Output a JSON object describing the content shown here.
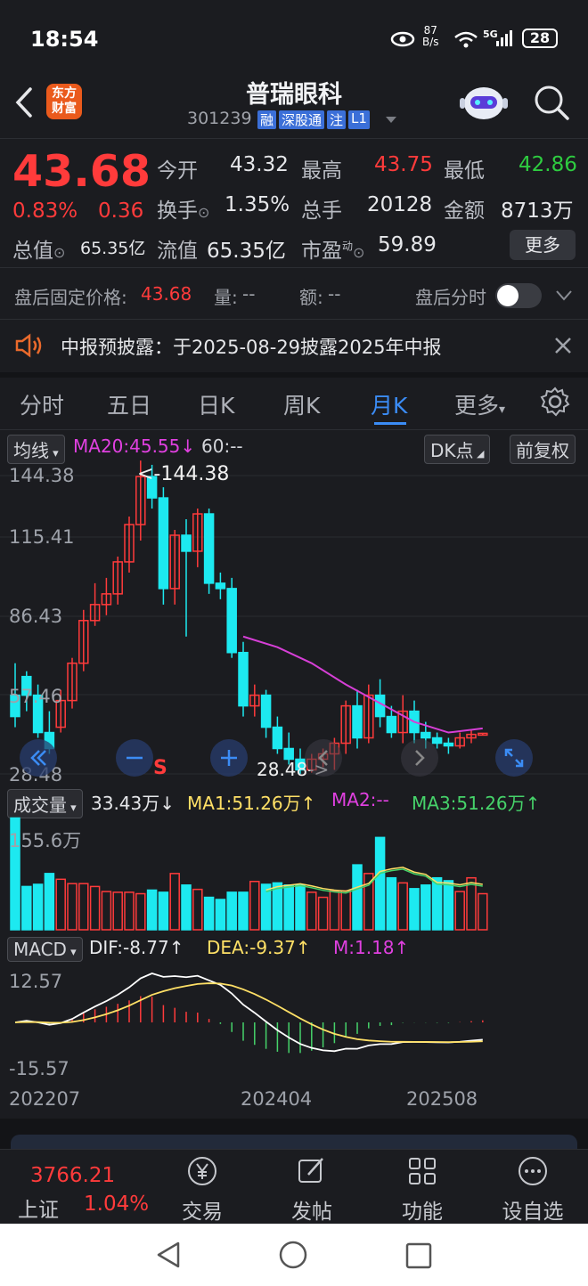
{
  "status": {
    "time": "18:54",
    "net_speed_value": "87",
    "net_speed_unit": "B/s",
    "signal": "5G",
    "battery": "28"
  },
  "header": {
    "app_logo_line1": "东方",
    "app_logo_line2": "财富",
    "stock_name": "普瑞眼科",
    "stock_code": "301239",
    "tags": [
      "融",
      "深股通",
      "注",
      "L1"
    ]
  },
  "quote": {
    "price": "43.68",
    "change_pct": "0.83%",
    "change": "0.36",
    "open_label": "今开",
    "open": "43.32",
    "high_label": "最高",
    "high": "43.75",
    "low_label": "最低",
    "low": "42.86",
    "turnover_label": "换手",
    "turnover": "1.35%",
    "volume_label": "总手",
    "volume": "20128",
    "amount_label": "金额",
    "amount": "8713万",
    "mktcap_label": "总值",
    "mktcap": "65.35亿",
    "float_label": "流值",
    "float_cap": "65.35亿",
    "pe_label": "市盈",
    "pe_sup": "动",
    "pe": "59.89",
    "more_label": "更多"
  },
  "afterhours": {
    "price_label": "盘后固定价格:",
    "price": "43.68",
    "vol_label": "量:",
    "vol": "--",
    "amt_label": "额:",
    "amt": "--",
    "switch_label": "盘后分时"
  },
  "notice": {
    "text": "中报预披露：于2025-08-29披露2025年中报"
  },
  "tabs": [
    "分时",
    "五日",
    "日K",
    "周K",
    "月K",
    "更多"
  ],
  "active_tab": "月K",
  "kline": {
    "ma_selector": "均线",
    "ma20_label": "MA20:45.55",
    "ma20_arrow": "↓",
    "ma60_label": "60:--",
    "dk_label": "DK点",
    "adjust_label": "前复权",
    "y_labels": [
      "144.38",
      "115.41",
      "86.43",
      "57.46",
      "28.48"
    ],
    "max_marker": "<-144.38",
    "min_marker": "28.48->",
    "s_marker": "S"
  },
  "volume": {
    "selector": "成交量",
    "value": "33.43万",
    "value_arrow": "↓",
    "ma1": "MA1:51.26万",
    "ma1_arrow": "↑",
    "ma2": "MA2:--",
    "ma3": "MA3:51.26万",
    "ma3_arrow": "↑",
    "y_max": "155.6万"
  },
  "macd": {
    "selector": "MACD",
    "dif": "DIF:-8.77",
    "dif_arrow": "↑",
    "dea": "DEA:-9.37",
    "dea_arrow": "↑",
    "m": "M:1.18",
    "m_arrow": "↑",
    "y_top": "12.57",
    "y_bottom": "-15.57"
  },
  "x_labels": [
    "202207",
    "202404",
    "202508"
  ],
  "bottom": {
    "index_value": "3766.21",
    "index_name": "上证",
    "index_change": "1.04%",
    "items": [
      "交易",
      "发帖",
      "功能",
      "设自选"
    ]
  },
  "colors": {
    "up": "#ff3b3b",
    "down": "#1de9f0",
    "ma20": "#d63fd6",
    "accent": "#3b8cf5"
  },
  "chart_data": {
    "type": "candlestick",
    "ylim": [
      28.48,
      144.38
    ],
    "candles": [
      [
        58,
        70,
        46,
        50
      ],
      [
        65,
        67,
        52,
        58
      ],
      [
        58,
        62,
        42,
        44
      ],
      [
        44,
        52,
        36,
        38
      ],
      [
        46,
        60,
        44,
        56
      ],
      [
        56,
        72,
        53,
        70
      ],
      [
        70,
        90,
        67,
        86
      ],
      [
        86,
        100,
        84,
        92
      ],
      [
        92,
        102,
        88,
        96
      ],
      [
        96,
        110,
        92,
        108
      ],
      [
        108,
        125,
        104,
        122
      ],
      [
        122,
        146,
        116,
        140
      ],
      [
        140,
        144.4,
        128,
        132
      ],
      [
        132,
        136,
        92,
        98
      ],
      [
        98,
        120,
        92,
        118
      ],
      [
        118,
        124,
        80,
        112
      ],
      [
        112,
        128,
        106,
        126
      ],
      [
        126,
        128,
        96,
        100
      ],
      [
        100,
        104,
        94,
        98
      ],
      [
        98,
        102,
        72,
        74
      ],
      [
        74,
        78,
        50,
        54
      ],
      [
        54,
        62,
        50,
        58
      ],
      [
        58,
        60,
        42,
        46
      ],
      [
        46,
        50,
        36,
        38
      ],
      [
        38,
        44,
        32,
        34
      ],
      [
        34,
        38,
        28.5,
        30
      ],
      [
        30,
        36,
        29,
        34
      ],
      [
        34,
        38,
        31,
        36
      ],
      [
        36,
        42,
        30,
        40
      ],
      [
        40,
        56,
        36,
        54
      ],
      [
        54,
        60,
        38,
        42
      ],
      [
        42,
        62,
        40,
        58
      ],
      [
        58,
        64,
        46,
        50
      ],
      [
        50,
        54,
        42,
        44
      ],
      [
        44,
        58,
        40,
        52
      ],
      [
        52,
        56,
        40,
        44
      ],
      [
        44,
        48,
        38,
        42
      ],
      [
        42,
        44,
        38,
        40
      ],
      [
        40,
        42,
        36,
        39
      ],
      [
        39,
        44,
        38,
        42
      ],
      [
        42,
        45,
        40,
        43.3
      ],
      [
        43.3,
        43.8,
        42.9,
        43.7
      ]
    ],
    "ma20": [
      [
        20,
        80
      ],
      [
        23,
        76
      ],
      [
        26,
        70
      ],
      [
        29,
        62
      ],
      [
        32,
        55
      ],
      [
        35,
        48
      ],
      [
        38,
        44
      ],
      [
        41,
        45.55
      ]
    ],
    "volume": [
      155,
      60,
      63,
      78,
      70,
      64,
      64,
      60,
      53,
      52,
      52,
      50,
      55,
      52,
      78,
      62,
      56,
      45,
      42,
      52,
      52,
      67,
      63,
      65,
      62,
      62,
      52,
      45,
      54,
      54,
      90,
      78,
      128,
      72,
      65,
      57,
      62,
      72,
      68,
      53,
      72,
      50
    ]
  }
}
